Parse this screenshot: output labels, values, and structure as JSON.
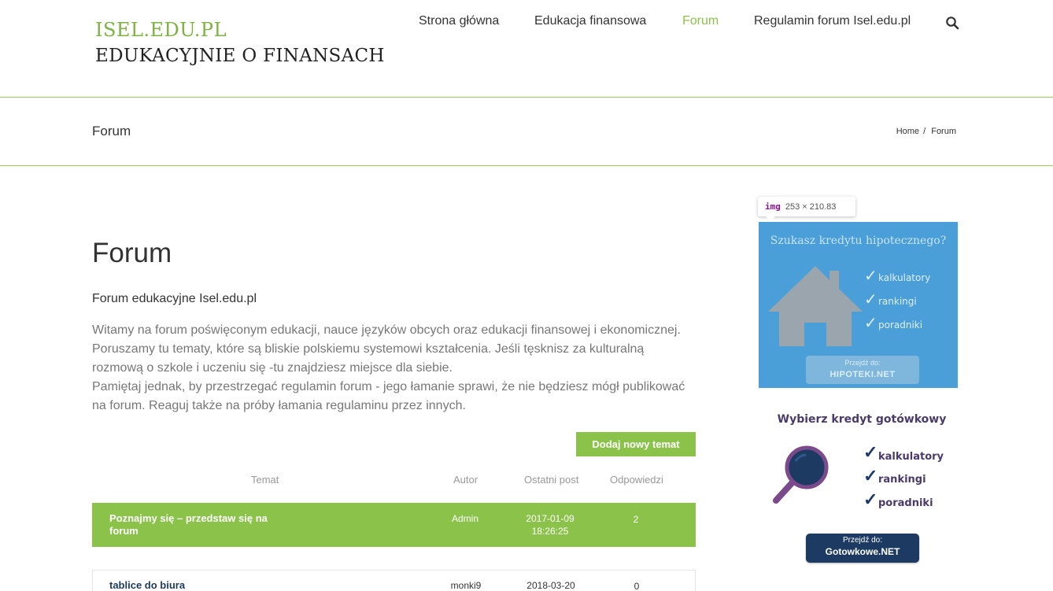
{
  "header": {
    "logo_line1": "ISEL.EDU.PL",
    "logo_line2": "EDUKACYJNIE O FINANSACH",
    "nav": [
      {
        "label": "Strona główna"
      },
      {
        "label": "Edukacja finansowa"
      },
      {
        "label": "Forum",
        "active": true
      },
      {
        "label": "Regulamin forum Isel.edu.pl"
      }
    ],
    "search_icon": "search-icon"
  },
  "titlebar": {
    "title": "Forum",
    "breadcrumb": [
      "Home",
      "Forum"
    ],
    "separator": "/"
  },
  "main": {
    "title": "Forum",
    "subtitle": "Forum edukacyjne Isel.edu.pl",
    "intro_lines": [
      "Witamy na forum poświęconym edukacji, nauce języków obcych oraz edukacji finansowej i ekonomicznej.",
      "Poruszamy tu tematy, które są bliskie polskiemu systemowi kształcenia. Jeśli tęsknisz za kulturalną",
      "rozmową o szkole i uczeniu się -tu znajdziesz miejsce dla siebie.",
      "Pamiętaj jednak, by przestrzegać regulamin forum - jego łamanie sprawi, że nie będziesz mógł publikować",
      "na forum. Reaguj także na próby łamania regulaminu przez innych."
    ],
    "new_topic_button": "Dodaj nowy temat",
    "table": {
      "headers": [
        "Temat",
        "Autor",
        "Ostatni post",
        "Odpowiedzi"
      ],
      "rows": [
        {
          "topic": "Poznajmy się – przedstaw się na forum",
          "author": "Admin",
          "last_post_date": "2017-01-09",
          "last_post_time": "18:26:25",
          "replies": "2",
          "highlighted": true
        },
        {
          "topic": "tablice do biura",
          "author": "monki9",
          "last_post_date": "2018-03-20",
          "last_post_time": "",
          "replies": "0",
          "highlighted": false
        }
      ]
    }
  },
  "devtools_tooltip": {
    "tag": "img",
    "dimensions": "253 × 210.83"
  },
  "sidebar": {
    "ad1": {
      "title": "Szukasz kredytu hipotecznego?",
      "items": [
        "kalkulatory",
        "rankingi",
        "poradniki"
      ],
      "button_small": "Przejdź do:",
      "button_big": "HIPOTEKI.NET",
      "bg_color": "#4a9fd8"
    },
    "ad2": {
      "title": "Wybierz kredyt gotówkowy",
      "items": [
        "kalkulatory",
        "rankingi",
        "poradniki"
      ],
      "button_small": "Przejdź do:",
      "button_big": "Gotowkowe.NET",
      "icon": "magnifier-icon"
    }
  },
  "colors": {
    "accent": "#8bc34a",
    "text": "#333333",
    "muted": "#777777"
  }
}
